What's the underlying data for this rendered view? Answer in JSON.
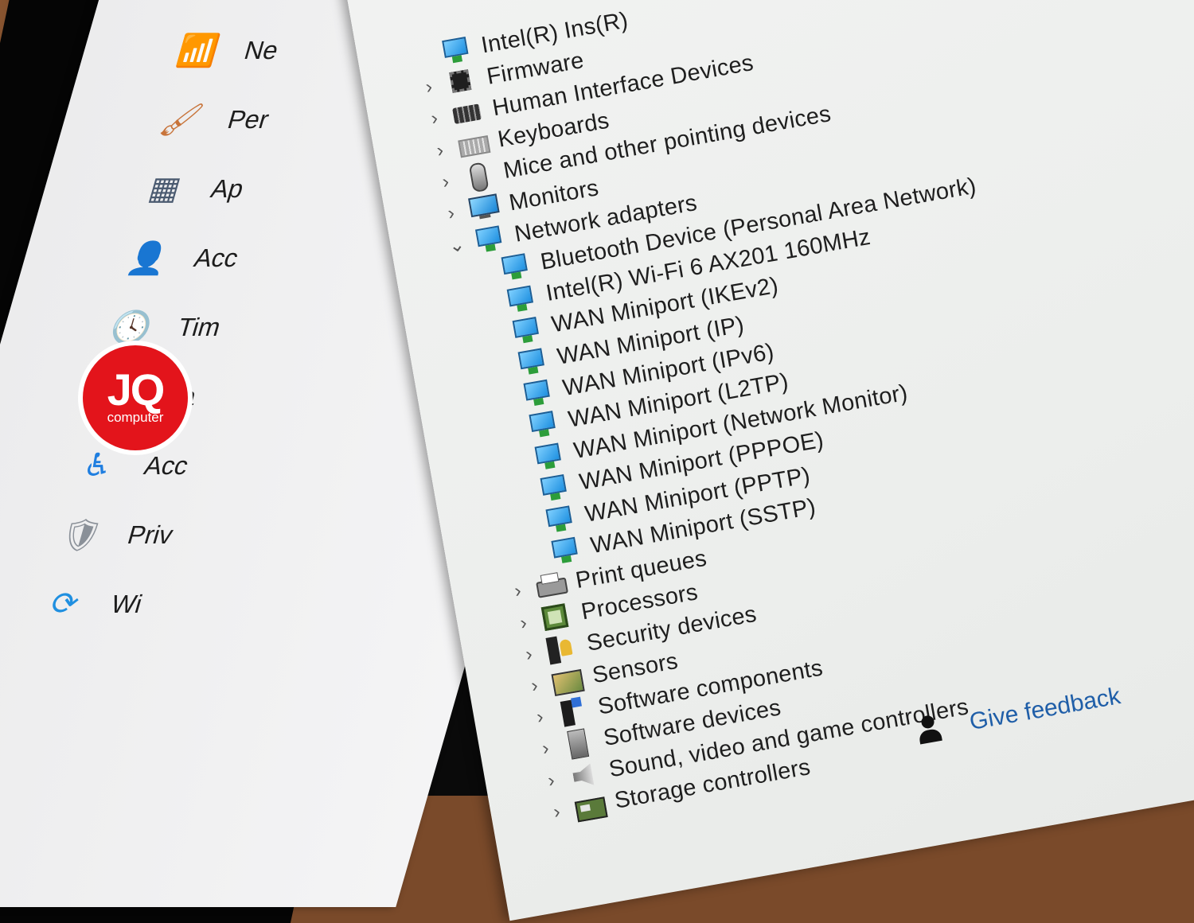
{
  "settings_nav": [
    {
      "label": "Ne",
      "icon": "wifi-icon"
    },
    {
      "label": "Per",
      "icon": "brush-icon"
    },
    {
      "label": "Ap",
      "icon": "apps-icon"
    },
    {
      "label": "Acc",
      "icon": "account-icon"
    },
    {
      "label": "Tim",
      "icon": "clock-globe-icon"
    },
    {
      "label": "Ga",
      "icon": "gamepad-icon"
    },
    {
      "label": "Acc",
      "icon": "accessibility-icon"
    },
    {
      "label": "Priv",
      "icon": "shield-icon"
    },
    {
      "label": "Wi",
      "icon": "update-icon"
    }
  ],
  "device_tree": [
    {
      "label": "Intel(R) Ins(R)",
      "icon": "net",
      "expand": ""
    },
    {
      "label": "Firmware",
      "icon": "chip",
      "expand": "›"
    },
    {
      "label": "Human Interface Devices",
      "icon": "hid",
      "expand": "›"
    },
    {
      "label": "Keyboards",
      "icon": "kb",
      "expand": "›"
    },
    {
      "label": "Mice and other pointing devices",
      "icon": "mouse",
      "expand": "›"
    },
    {
      "label": "Monitors",
      "icon": "mon",
      "expand": "›"
    },
    {
      "label": "Network adapters",
      "icon": "net",
      "expand": "⌄"
    },
    {
      "label": "Bluetooth Device (Personal Area Network)",
      "icon": "net",
      "expand": "",
      "child": true
    },
    {
      "label": "Intel(R) Wi-Fi 6 AX201 160MHz",
      "icon": "net",
      "expand": "",
      "child": true
    },
    {
      "label": "WAN Miniport (IKEv2)",
      "icon": "net",
      "expand": "",
      "child": true
    },
    {
      "label": "WAN Miniport (IP)",
      "icon": "net",
      "expand": "",
      "child": true
    },
    {
      "label": "WAN Miniport (IPv6)",
      "icon": "net",
      "expand": "",
      "child": true
    },
    {
      "label": "WAN Miniport (L2TP)",
      "icon": "net",
      "expand": "",
      "child": true
    },
    {
      "label": "WAN Miniport (Network Monitor)",
      "icon": "net",
      "expand": "",
      "child": true
    },
    {
      "label": "WAN Miniport (PPPOE)",
      "icon": "net",
      "expand": "",
      "child": true
    },
    {
      "label": "WAN Miniport (PPTP)",
      "icon": "net",
      "expand": "",
      "child": true
    },
    {
      "label": "WAN Miniport (SSTP)",
      "icon": "net",
      "expand": "",
      "child": true
    },
    {
      "label": "Print queues",
      "icon": "print",
      "expand": "›"
    },
    {
      "label": "Processors",
      "icon": "proc",
      "expand": "›"
    },
    {
      "label": "Security devices",
      "icon": "sec",
      "expand": "›"
    },
    {
      "label": "Sensors",
      "icon": "sens",
      "expand": "›"
    },
    {
      "label": "Software components",
      "icon": "swc",
      "expand": "›"
    },
    {
      "label": "Software devices",
      "icon": "swd",
      "expand": "›"
    },
    {
      "label": "Sound, video and game controllers",
      "icon": "snd",
      "expand": "›"
    },
    {
      "label": "Storage controllers",
      "icon": "sto",
      "expand": "›"
    }
  ],
  "feedback": {
    "label": "Give feedback",
    "icon": "feedback-person-icon"
  },
  "logo": {
    "big": "JQ",
    "small": "computer"
  }
}
